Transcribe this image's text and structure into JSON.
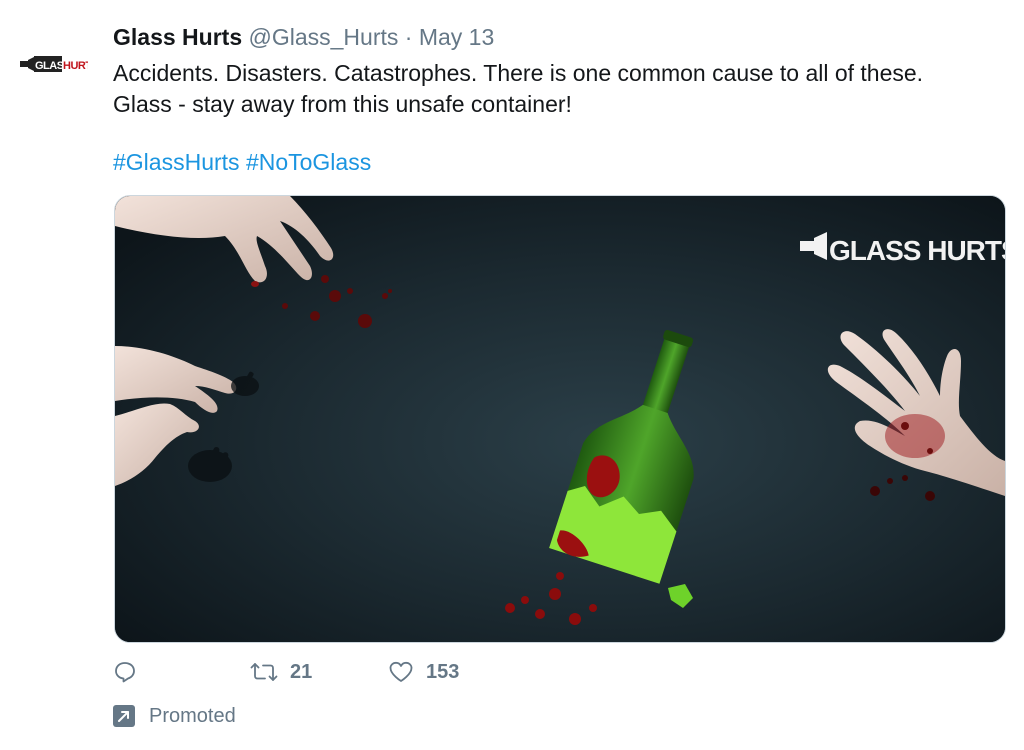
{
  "tweet": {
    "name": "Glass Hurts",
    "handle": "@Glass_Hurts",
    "separator": "·",
    "date": "May 13",
    "text_line1": "Accidents. Disasters. Catastrophes. There is one common cause to all of these.",
    "text_line2": "Glass - stay away from this unsafe container!",
    "hashtags": [
      "#GlassHurts",
      "#NoToGlass"
    ],
    "avatar_logo_text": "GLASS HURTS",
    "media": {
      "logo_text": "GLASS HURTS",
      "colors": {
        "background": "#1c2a31",
        "bottle": "#3f8f1f",
        "bottle_highlight": "#8ee63a",
        "blood": "#9b1010",
        "skin": "#e9d6cd"
      }
    }
  },
  "actions": {
    "reply_icon": "reply-icon",
    "retweet_icon": "retweet-icon",
    "retweet_count": "21",
    "like_icon": "heart-icon",
    "like_count": "153"
  },
  "promoted": {
    "icon": "promoted-arrow-icon",
    "label": "Promoted"
  },
  "colors": {
    "text": "#14171a",
    "secondary": "#657786",
    "link": "#1b95e0",
    "border": "#ccd6dd"
  }
}
